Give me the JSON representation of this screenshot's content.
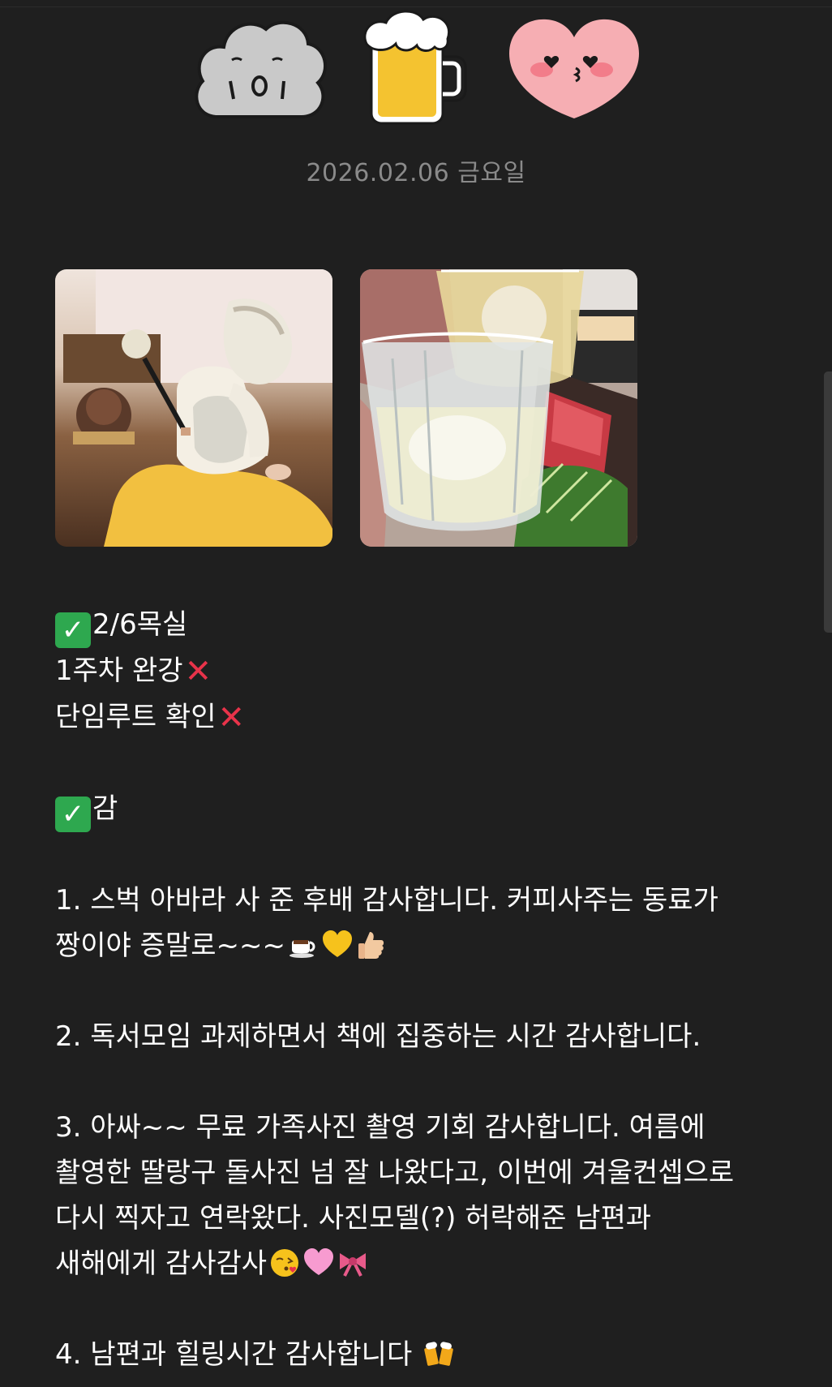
{
  "header": {
    "stickers": [
      "sad-cloud-sticker",
      "beer-mug-sticker",
      "kissing-heart-sticker"
    ],
    "date": "2026.02.06 금요일"
  },
  "photos": [
    {
      "name": "baby-hanbok-photo",
      "description_icon": "photo-icon"
    },
    {
      "name": "toast-glasses-photo",
      "description_icon": "photo-icon"
    }
  ],
  "body": {
    "section1_title": "2/6목실",
    "item_lecture": "1주차 완강",
    "item_route": "단임루트 확인",
    "section2_title": "감",
    "g1_line1": "1. 스벅 아바라 사 준 후배 감사합니다. 커피사주는 동료가",
    "g1_line2": "짱이야 증말로~~~",
    "g2": "2. 독서모임 과제하면서 책에 집중하는 시간 감사합니다.",
    "g3_line1": "3. 아싸~~ 무료 가족사진 촬영 기회 감사합니다. 여름에",
    "g3_line2": "촬영한 딸랑구 돌사진 넘 잘 나왔다고, 이번에 겨울컨셉으로",
    "g3_line3": "다시 찍자고 연락왔다. 사진모델(?) 허락해준 남편과",
    "g3_line4": "새해에게 감사감사",
    "g4": "4. 남편과 힐링시간 감사합니다"
  },
  "icons": {
    "check": "✓",
    "cross": "✕"
  },
  "colors": {
    "background": "#1f1f1f",
    "text": "#ffffff",
    "date": "#8a8a8a",
    "check": "#2ea84f",
    "cross": "#e8334a"
  }
}
